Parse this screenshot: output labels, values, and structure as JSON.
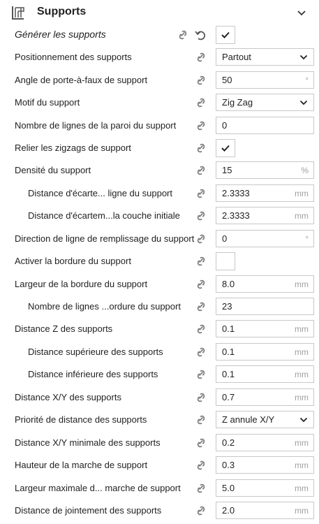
{
  "section": {
    "title": "Supports",
    "icon": "support-section-icon"
  },
  "rows": [
    {
      "label": "Générer les supports",
      "type": "check",
      "checked": true
    },
    {
      "label": "Positionnement des supports",
      "type": "select",
      "value": "Partout"
    },
    {
      "label": "Angle de porte-à-faux de support",
      "type": "number",
      "value": "50",
      "unit": "°"
    },
    {
      "label": "Motif du support",
      "type": "select",
      "value": "Zig Zag"
    },
    {
      "label": "Nombre de lignes de la paroi du support",
      "type": "number",
      "value": "0",
      "unit": ""
    },
    {
      "label": "Relier les zigzags de support",
      "type": "check",
      "checked": true
    },
    {
      "label": "Densité du support",
      "type": "number",
      "value": "15",
      "unit": "%"
    },
    {
      "label": "Distance d'écarte... ligne du support",
      "type": "number",
      "value": "2.3333",
      "unit": "mm"
    },
    {
      "label": "Distance d'écartem...la couche initiale",
      "type": "number",
      "value": "2.3333",
      "unit": "mm"
    },
    {
      "label": "Direction de ligne de remplissage du support",
      "type": "number",
      "value": "0",
      "unit": "°"
    },
    {
      "label": "Activer la bordure du support",
      "type": "check",
      "checked": false
    },
    {
      "label": "Largeur de la bordure du support",
      "type": "number",
      "value": "8.0",
      "unit": "mm"
    },
    {
      "label": "Nombre de lignes ...ordure du support",
      "type": "number",
      "value": "23",
      "unit": ""
    },
    {
      "label": "Distance Z des supports",
      "type": "number",
      "value": "0.1",
      "unit": "mm"
    },
    {
      "label": "Distance supérieure des supports",
      "type": "number",
      "value": "0.1",
      "unit": "mm"
    },
    {
      "label": "Distance inférieure des supports",
      "type": "number",
      "value": "0.1",
      "unit": "mm"
    },
    {
      "label": "Distance X/Y des supports",
      "type": "number",
      "value": "0.7",
      "unit": "mm"
    },
    {
      "label": "Priorité de distance des supports",
      "type": "select",
      "value": "Z annule X/Y"
    },
    {
      "label": "Distance X/Y minimale des supports",
      "type": "number",
      "value": "0.2",
      "unit": "mm"
    },
    {
      "label": "Hauteur de la marche de support",
      "type": "number",
      "value": "0.3",
      "unit": "mm"
    },
    {
      "label": "Largeur maximale d... marche de support",
      "type": "number",
      "value": "5.0",
      "unit": "mm"
    },
    {
      "label": "Distance de jointement des supports",
      "type": "number",
      "value": "2.0",
      "unit": "mm"
    }
  ]
}
